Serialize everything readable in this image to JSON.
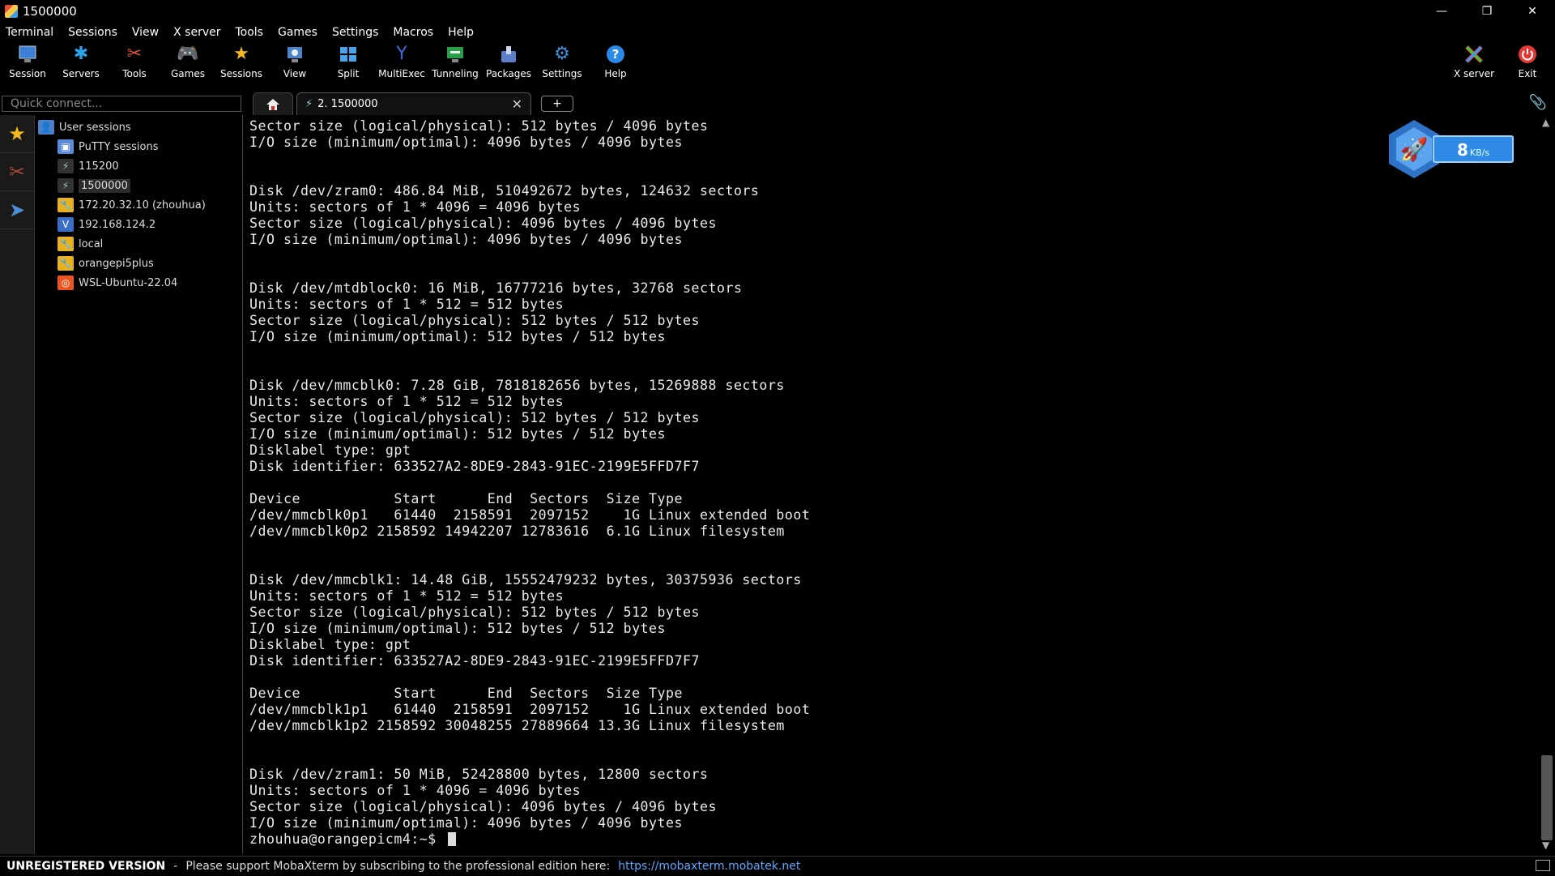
{
  "window": {
    "title": "1500000",
    "minimize": "—",
    "restore": "❐",
    "close": "✕"
  },
  "menu": [
    "Terminal",
    "Sessions",
    "View",
    "X server",
    "Tools",
    "Games",
    "Settings",
    "Macros",
    "Help"
  ],
  "toolbar": {
    "session": "Session",
    "servers": "Servers",
    "tools": "Tools",
    "games": "Games",
    "sessions": "Sessions",
    "view": "View",
    "split": "Split",
    "multiexec": "MultiExec",
    "tunneling": "Tunneling",
    "packages": "Packages",
    "settings": "Settings",
    "help": "Help",
    "xserver": "X server",
    "exit": "Exit"
  },
  "quick_connect": {
    "placeholder": "Quick connect..."
  },
  "tabs": {
    "session_label": "2. 1500000",
    "close": "✕",
    "new": "+"
  },
  "sidebar": {
    "root": "User sessions",
    "items": [
      "PuTTY sessions",
      "115200",
      "1500000",
      "172.20.32.10 (zhouhua)",
      "192.168.124.2",
      "local",
      "orangepi5plus",
      "WSL-Ubuntu-22.04"
    ]
  },
  "speed": {
    "value": "8",
    "unit": "KB/s"
  },
  "terminal": {
    "lines": [
      "Sector size (logical/physical): 512 bytes / 4096 bytes",
      "I/O size (minimum/optimal): 4096 bytes / 4096 bytes",
      "",
      "",
      "Disk /dev/zram0: 486.84 MiB, 510492672 bytes, 124632 sectors",
      "Units: sectors of 1 * 4096 = 4096 bytes",
      "Sector size (logical/physical): 4096 bytes / 4096 bytes",
      "I/O size (minimum/optimal): 4096 bytes / 4096 bytes",
      "",
      "",
      "Disk /dev/mtdblock0: 16 MiB, 16777216 bytes, 32768 sectors",
      "Units: sectors of 1 * 512 = 512 bytes",
      "Sector size (logical/physical): 512 bytes / 512 bytes",
      "I/O size (minimum/optimal): 512 bytes / 512 bytes",
      "",
      "",
      "Disk /dev/mmcblk0: 7.28 GiB, 7818182656 bytes, 15269888 sectors",
      "Units: sectors of 1 * 512 = 512 bytes",
      "Sector size (logical/physical): 512 bytes / 512 bytes",
      "I/O size (minimum/optimal): 512 bytes / 512 bytes",
      "Disklabel type: gpt",
      "Disk identifier: 633527A2-8DE9-2843-91EC-2199E5FFD7F7",
      "",
      "Device           Start      End  Sectors  Size Type",
      "/dev/mmcblk0p1   61440  2158591  2097152    1G Linux extended boot",
      "/dev/mmcblk0p2 2158592 14942207 12783616  6.1G Linux filesystem",
      "",
      "",
      "Disk /dev/mmcblk1: 14.48 GiB, 15552479232 bytes, 30375936 sectors",
      "Units: sectors of 1 * 512 = 512 bytes",
      "Sector size (logical/physical): 512 bytes / 512 bytes",
      "I/O size (minimum/optimal): 512 bytes / 512 bytes",
      "Disklabel type: gpt",
      "Disk identifier: 633527A2-8DE9-2843-91EC-2199E5FFD7F7",
      "",
      "Device           Start      End  Sectors  Size Type",
      "/dev/mmcblk1p1   61440  2158591  2097152    1G Linux extended boot",
      "/dev/mmcblk1p2 2158592 30048255 27889664 13.3G Linux filesystem",
      "",
      "",
      "Disk /dev/zram1: 50 MiB, 52428800 bytes, 12800 sectors",
      "Units: sectors of 1 * 4096 = 4096 bytes",
      "Sector size (logical/physical): 4096 bytes / 4096 bytes",
      "I/O size (minimum/optimal): 4096 bytes / 4096 bytes"
    ],
    "prompt": "zhouhua@orangepicm4:~$ "
  },
  "status": {
    "unregistered": "UNREGISTERED VERSION",
    "separator": "-",
    "message": "Please support MobaXterm by subscribing to the professional edition here:",
    "link": "https://mobaxterm.mobatek.net"
  }
}
